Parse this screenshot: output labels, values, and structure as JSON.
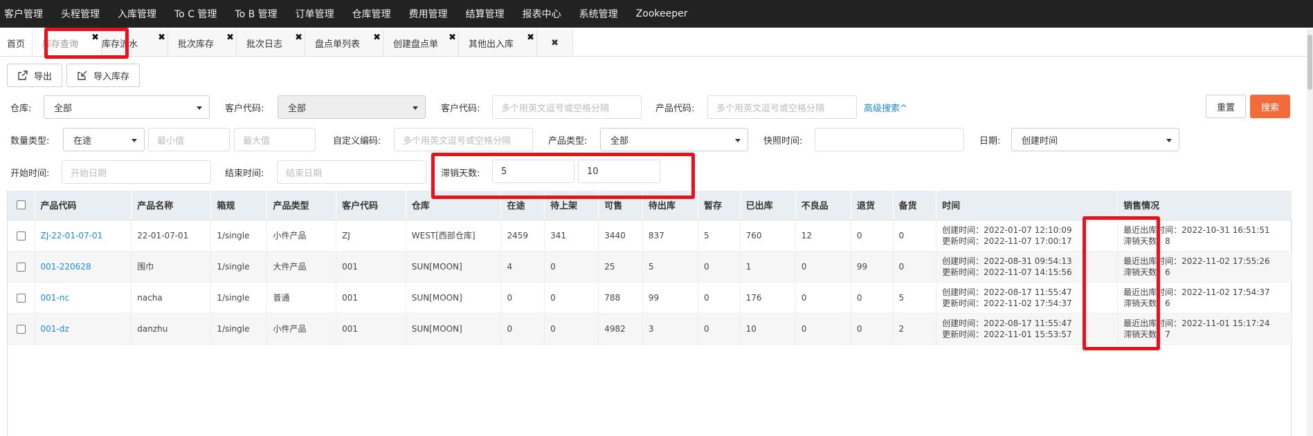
{
  "topnav": [
    "客户管理",
    "头程管理",
    "入库管理",
    "To C 管理",
    "To B 管理",
    "订单管理",
    "仓库管理",
    "费用管理",
    "结算管理",
    "报表中心",
    "系统管理",
    "Zookeeper"
  ],
  "tabs": {
    "home": "首页",
    "items": [
      "库存查询",
      "库存流水",
      "批次库存",
      "批次日志",
      "盘点单列表",
      "创建盘点单",
      "其他出入库"
    ],
    "close_glyph": "✖"
  },
  "toolbar": {
    "export": "导出",
    "import": "导入库存"
  },
  "filters": {
    "warehouse_label": "仓库:",
    "warehouse_value": "全部",
    "customer_code_label": "客户代码:",
    "customer_code_select": "全部",
    "customer_code2_label": "客户代码:",
    "customer_code2_placeholder": "多个用英文逗号或空格分隔",
    "product_code_label": "产品代码:",
    "product_code_placeholder": "多个用英文逗号或空格分隔",
    "advanced_search": "高级搜索^",
    "reset": "重置",
    "search": "搜索",
    "qty_type_label": "数量类型:",
    "qty_type_value": "在途",
    "min_placeholder": "最小值",
    "max_placeholder": "最大值",
    "custom_code_label": "自定义编码:",
    "custom_code_placeholder": "多个用英文逗号或空格分隔",
    "product_type_label": "产品类型:",
    "product_type_value": "全部",
    "snapshot_label": "快照时间:",
    "date_label": "日期:",
    "date_value": "创建时间",
    "start_label": "开始时间:",
    "start_placeholder": "开始日期",
    "end_label": "结束时间:",
    "end_placeholder": "结束日期",
    "stagnant_label": "滞销天数:",
    "stagnant_min": "5",
    "stagnant_max": "10"
  },
  "table": {
    "headers": [
      "产品代码",
      "产品名称",
      "箱规",
      "产品类型",
      "客户代码",
      "仓库",
      "在途",
      "待上架",
      "可售",
      "待出库",
      "暂存",
      "已出库",
      "不良品",
      "退货",
      "备货",
      "时间",
      "销售情况"
    ],
    "rows": [
      {
        "code": "ZJ-22-01-07-01",
        "name": "22-01-07-01",
        "spec": "1/single",
        "type": "小件产品",
        "customer": "ZJ",
        "warehouse": "WEST[西部仓库]",
        "in_transit": "2459",
        "to_shelve": "341",
        "sellable": "3440",
        "to_ship": "837",
        "temp": "5",
        "shipped": "760",
        "defective": "12",
        "returned": "0",
        "stock_prep": "0",
        "time1": "创建时间：2022-01-07 12:10:09",
        "time2": "更新时间：2022-11-07 17:00:17",
        "sale1": "最近出库时间：2022-10-31 16:51:51",
        "sale2": "滞销天数：8"
      },
      {
        "code": "001-220628",
        "name": "围巾",
        "spec": "1/single",
        "type": "大件产品",
        "customer": "001",
        "warehouse": "SUN[MOON]",
        "in_transit": "4",
        "to_shelve": "0",
        "sellable": "25",
        "to_ship": "5",
        "temp": "0",
        "shipped": "1",
        "defective": "0",
        "returned": "99",
        "stock_prep": "0",
        "time1": "创建时间：2022-08-31 09:54:13",
        "time2": "更新时间：2022-11-07 14:15:56",
        "sale1": "最近出库时间：2022-11-02 17:55:26",
        "sale2": "滞销天数：6"
      },
      {
        "code": "001-nc",
        "name": "nacha",
        "spec": "1/single",
        "type": "普通",
        "customer": "001",
        "warehouse": "SUN[MOON]",
        "in_transit": "0",
        "to_shelve": "0",
        "sellable": "788",
        "to_ship": "99",
        "temp": "0",
        "shipped": "176",
        "defective": "0",
        "returned": "0",
        "stock_prep": "5",
        "time1": "创建时间：2022-08-17 11:55:47",
        "time2": "更新时间：2022-11-02 17:54:37",
        "sale1": "最近出库时间：2022-11-02 17:54:37",
        "sale2": "滞销天数：6"
      },
      {
        "code": "001-dz",
        "name": "danzhu",
        "spec": "1/single",
        "type": "小件产品",
        "customer": "001",
        "warehouse": "SUN[MOON]",
        "in_transit": "0",
        "to_shelve": "0",
        "sellable": "4982",
        "to_ship": "3",
        "temp": "0",
        "shipped": "10",
        "defective": "0",
        "returned": "0",
        "stock_prep": "2",
        "time1": "创建时间：2022-08-17 11:55:47",
        "time2": "更新时间：2022-11-01 15:53:57",
        "sale1": "最近出库时间：2022-11-01 15:17:24",
        "sale2": "滞销天数：7"
      }
    ]
  },
  "colors": {
    "nav_bg": "#222222",
    "search_btn": "#f26b3a",
    "link": "#1a8bd6",
    "highlight": "#e8121c"
  }
}
